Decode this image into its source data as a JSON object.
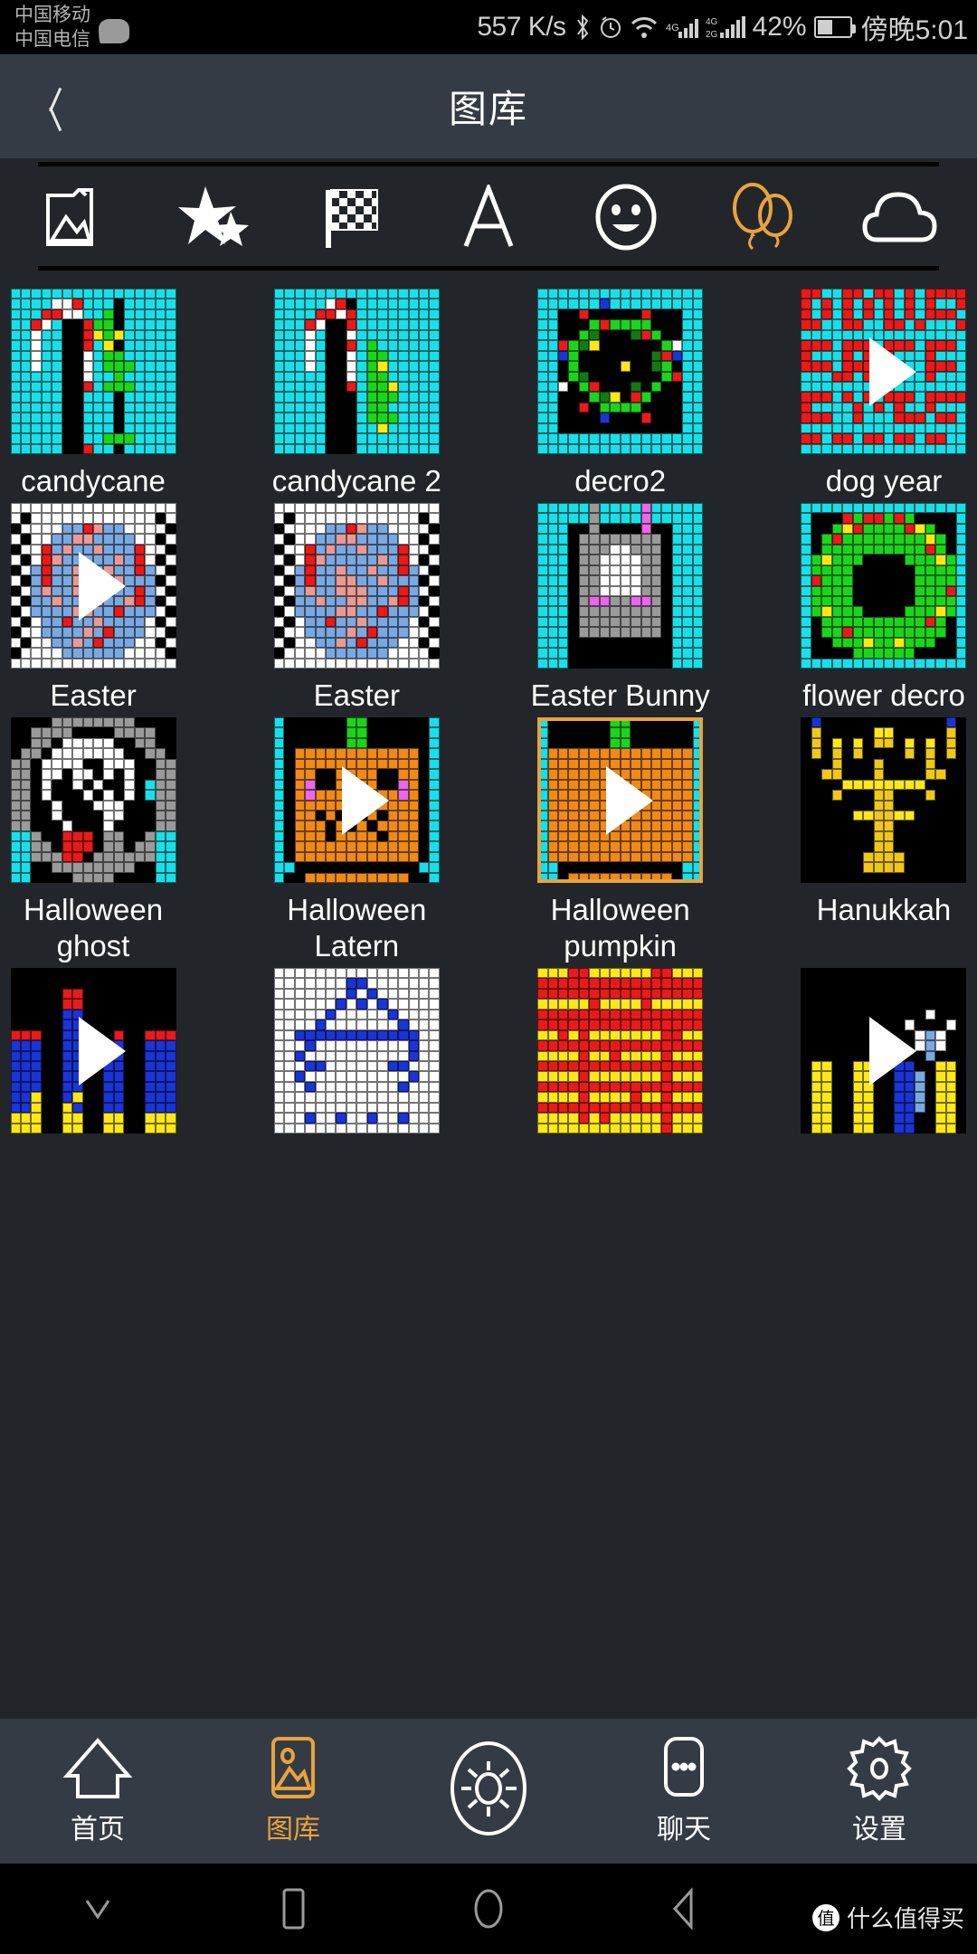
{
  "statusbar": {
    "carrier1": "中国移动",
    "carrier2": "中国电信",
    "net_speed": "557 K/s",
    "battery_pct": "42%",
    "time": "傍晚5:01",
    "icons": [
      "message-bubble-icon",
      "bluetooth-icon",
      "alarm-clock-icon",
      "wifi-icon",
      "signal-4g-icon",
      "signal-4g-2g-icon",
      "battery-icon"
    ]
  },
  "titlebar": {
    "title": "图库",
    "back_icon": "back-chevron-icon"
  },
  "categories": [
    {
      "name": "photo-folder-icon",
      "label": "Photos",
      "active": false
    },
    {
      "name": "stars-icon",
      "label": "Stars",
      "active": false
    },
    {
      "name": "checkered-flag-icon",
      "label": "Flag",
      "active": false
    },
    {
      "name": "letter-a-icon",
      "label": "Text",
      "active": false
    },
    {
      "name": "smiley-face-icon",
      "label": "Emoji",
      "active": false
    },
    {
      "name": "balloons-icon",
      "label": "Holiday",
      "active": true
    },
    {
      "name": "cloud-icon",
      "label": "Cloud",
      "active": false
    }
  ],
  "accent_color": "#e8a33d",
  "background_color": "#22262a",
  "header_color": "#353b45",
  "gallery": {
    "rows": [
      [
        {
          "label": "candycane",
          "selected": false,
          "has_play": false,
          "bg": "#19e0e8",
          "art": "candycane"
        },
        {
          "label": "candycane 2",
          "selected": false,
          "has_play": false,
          "bg": "#19e0e8",
          "art": "candycane2"
        },
        {
          "label": "decro2",
          "selected": false,
          "has_play": false,
          "bg": "#19e0e8",
          "art": "decro2"
        },
        {
          "label": "dog year",
          "selected": false,
          "has_play": true,
          "bg": "#19e0e8",
          "art": "dogyear"
        }
      ],
      [
        {
          "label": "Easter",
          "selected": false,
          "has_play": true,
          "bg": "#ffffff",
          "art": "easter"
        },
        {
          "label": "Easter",
          "selected": false,
          "has_play": false,
          "bg": "#ffffff",
          "art": "easter"
        },
        {
          "label": "Easter Bunny",
          "selected": false,
          "has_play": false,
          "bg": "#19e0e8",
          "art": "bunny"
        },
        {
          "label": "flower decro",
          "selected": false,
          "has_play": false,
          "bg": "#19e0e8",
          "art": "flowerdecro"
        }
      ],
      [
        {
          "label": "Halloween ghost",
          "selected": false,
          "has_play": false,
          "bg": "#000000",
          "art": "ghost"
        },
        {
          "label": "Halloween Latern",
          "selected": false,
          "has_play": true,
          "bg": "#19e0e8",
          "art": "lantern"
        },
        {
          "label": "Halloween pumpkin",
          "selected": true,
          "has_play": true,
          "bg": "#19e0e8",
          "art": "pumpkin"
        },
        {
          "label": "Hanukkah",
          "selected": false,
          "has_play": false,
          "bg": "#000000",
          "art": "hanukkah"
        }
      ],
      [
        {
          "label": "",
          "selected": false,
          "has_play": true,
          "bg": "#000000",
          "art": "bars1"
        },
        {
          "label": "",
          "selected": false,
          "has_play": false,
          "bg": "#ffffff",
          "art": "car"
        },
        {
          "label": "",
          "selected": false,
          "has_play": false,
          "bg": "#ffff00",
          "art": "redyellow"
        },
        {
          "label": "",
          "selected": false,
          "has_play": true,
          "bg": "#000000",
          "art": "bars2"
        }
      ]
    ]
  },
  "bottomnav": {
    "items": [
      {
        "label": "首页",
        "icon": "home-icon",
        "active": false
      },
      {
        "label": "图库",
        "icon": "gallery-icon",
        "active": true
      },
      {
        "label": "",
        "icon": "brightness-sun-icon",
        "active": false
      },
      {
        "label": "聊天",
        "icon": "chat-icon",
        "active": false
      },
      {
        "label": "设置",
        "icon": "settings-gear-icon",
        "active": false
      }
    ]
  },
  "androidnav": {
    "items": [
      "chevron-down-icon",
      "recents-square-icon",
      "home-circle-icon",
      "back-triangle-icon"
    ],
    "watermark_mark": "值",
    "watermark_text": "什么值得买"
  }
}
